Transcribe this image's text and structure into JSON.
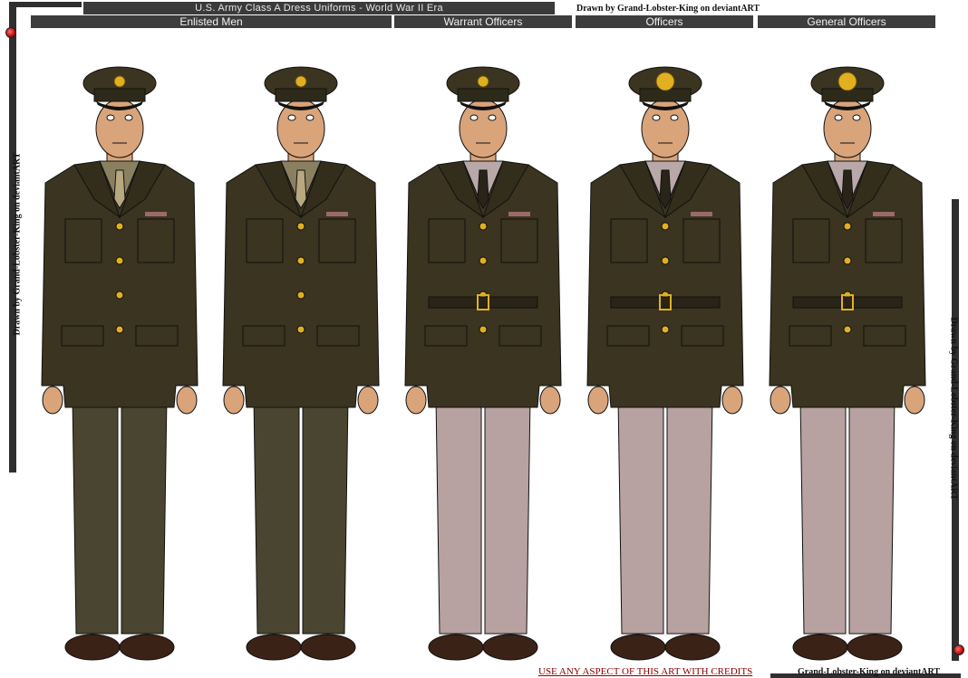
{
  "title": "U.S. Army Class A Dress Uniforms - World War II Era",
  "credit_top": "Drawn by Grand-Lobster-King on deviantART",
  "columns": {
    "enlisted": "Enlisted Men",
    "warrant": "Warrant Officers",
    "officers": "Officers",
    "general": "General Officers"
  },
  "side_credit_left": "Drawn by Grand-Lobster-King on deviantART",
  "side_credit_right": "Drawn by Grand-Lobster-King on deviantART",
  "bottom_note": "USE ANY ASPECT OF THIS ART WITH CREDITS",
  "bottom_credit": "Grand-Lobster-King on deviantART",
  "colors": {
    "jacket": "#3a3420",
    "trousers_enlisted": "#4a4530",
    "trousers_officer": "#b7a1a1",
    "shirt_enlisted": "#8a8060",
    "shirt_officer": "#b8a8a8",
    "skin": "#d9a47a",
    "brass": "#e0b020"
  }
}
